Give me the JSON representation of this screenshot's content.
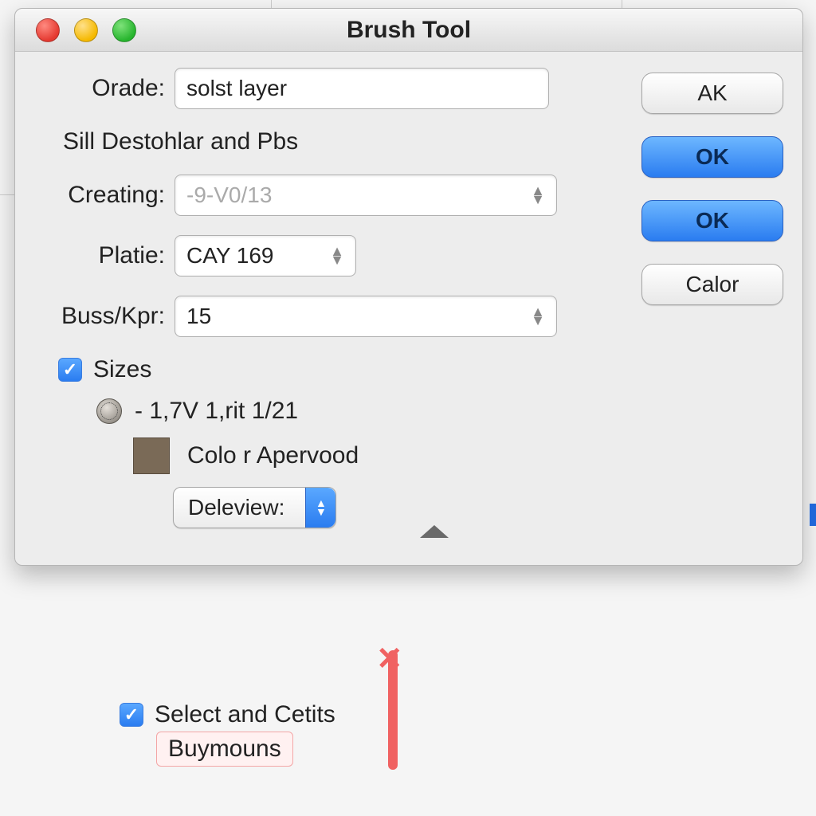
{
  "window": {
    "title": "Brush Tool"
  },
  "fields": {
    "orade": {
      "label": "Orade:",
      "value": "solst layer"
    },
    "section_label": "Sill Destohlar and Pbs",
    "creating": {
      "label": "Creating:",
      "value": "-9-V0/13"
    },
    "platie": {
      "label": "Platie:",
      "value": "CAY 169"
    },
    "busskpr": {
      "label": "Buss/Kpr:",
      "value": "15"
    }
  },
  "sizes": {
    "checkbox_label": "Sizes",
    "checked": true,
    "dial_text": "- 1,7V 1,rit 1/21",
    "color_label": "Colo r Apervood",
    "swatch_color": "#7a6a57",
    "popup_label": "Deleview:"
  },
  "buttons": {
    "ak": "AK",
    "ok1": "OK",
    "ok2": "OK",
    "calor": "Calor"
  },
  "below": {
    "checkbox_checked": true,
    "line1": "Select and Cetits",
    "highlight": "Buymouns"
  }
}
